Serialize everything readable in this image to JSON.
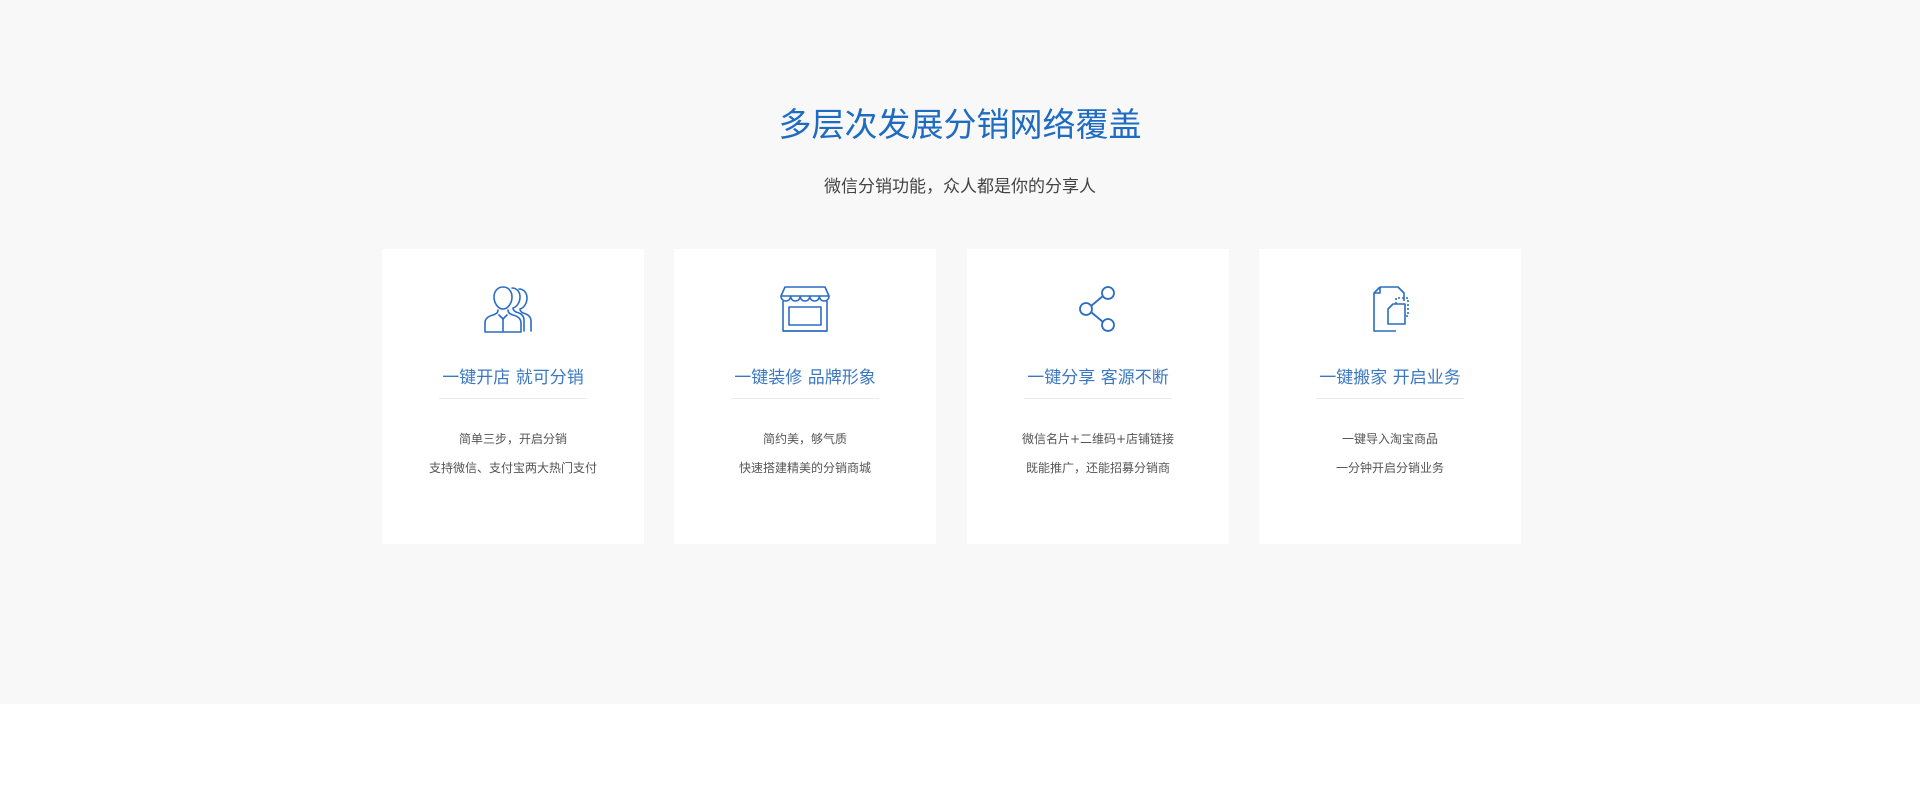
{
  "section": {
    "title": "多层次发展分销网络覆盖",
    "subtitle": "微信分销功能，众人都是你的分享人"
  },
  "cards": [
    {
      "icon": "users-icon",
      "title": "一键开店 就可分销",
      "line1": "简单三步，开启分销",
      "line2": "支持微信、支付宝两大热门支付"
    },
    {
      "icon": "storefront-icon",
      "title": "一键装修 品牌形象",
      "line1": "简约美，够气质",
      "line2": "快速搭建精美的分销商城"
    },
    {
      "icon": "share-icon",
      "title": "一键分享 客源不断",
      "line1": "微信名片+二维码+店铺链接",
      "line2": "既能推广，还能招募分销商"
    },
    {
      "icon": "copy-document-icon",
      "title": "一键搬家 开启业务",
      "line1": "一键导入淘宝商品",
      "line2": "一分钟开启分销业务"
    }
  ],
  "colors": {
    "accent": "#1e6bc2",
    "card_title": "#3b78c2",
    "background": "#f8f8f8"
  }
}
